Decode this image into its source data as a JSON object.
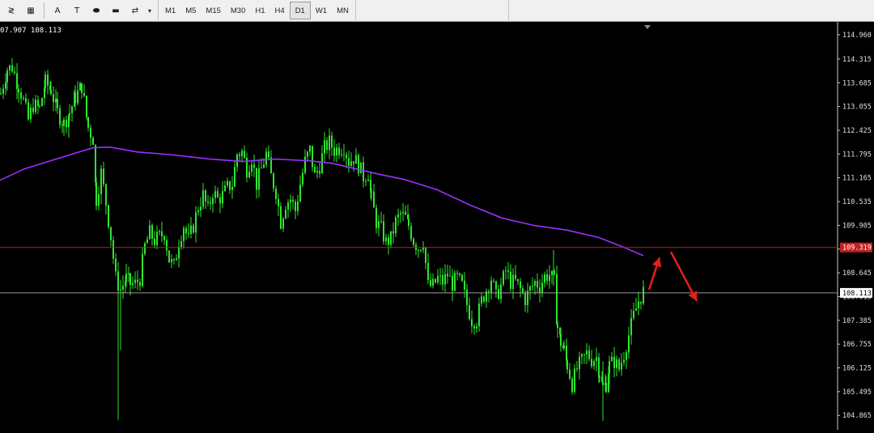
{
  "toolbar": {
    "tools": [
      {
        "name": "fibonacci-icon",
        "glyph": "≷"
      },
      {
        "name": "grid-icon",
        "glyph": "▦"
      },
      {
        "name": "text-icon",
        "glyph": "A"
      },
      {
        "name": "text-label-icon",
        "glyph": "T"
      },
      {
        "name": "ellipse-icon",
        "glyph": "⬬"
      },
      {
        "name": "rectangle-icon",
        "glyph": "▬"
      },
      {
        "name": "arrows-icon",
        "glyph": "⇄"
      }
    ],
    "dropdown_glyph": "▾",
    "timeframes": [
      "M1",
      "M5",
      "M15",
      "M30",
      "H1",
      "H4",
      "D1",
      "W1",
      "MN"
    ],
    "active_timeframe": "D1"
  },
  "chart_data": {
    "type": "candlestick",
    "header_text": "07.907 108.113",
    "price_labels": [
      "114.960",
      "114.315",
      "113.685",
      "113.055",
      "112.425",
      "111.795",
      "111.165",
      "110.535",
      "109.905",
      "109.275",
      "108.645",
      "108.015",
      "107.385",
      "106.755",
      "106.125",
      "105.495",
      "104.865"
    ],
    "ylim": [
      104.72,
      115.15
    ],
    "current_price": "108.113",
    "current_price_value": 108.113,
    "resistance_label": "109.319",
    "resistance_value": 109.319,
    "moving_average": {
      "color": "#9b30ff",
      "points": [
        [
          0,
          111.1
        ],
        [
          30,
          111.4
        ],
        [
          60,
          111.6
        ],
        [
          90,
          111.8
        ],
        [
          115,
          111.96
        ],
        [
          135,
          111.98
        ],
        [
          170,
          111.85
        ],
        [
          210,
          111.78
        ],
        [
          260,
          111.66
        ],
        [
          300,
          111.6
        ],
        [
          340,
          111.66
        ],
        [
          380,
          111.62
        ],
        [
          410,
          111.55
        ],
        [
          440,
          111.4
        ],
        [
          470,
          111.25
        ],
        [
          500,
          111.12
        ],
        [
          540,
          110.85
        ],
        [
          580,
          110.45
        ],
        [
          620,
          110.1
        ],
        [
          660,
          109.9
        ],
        [
          700,
          109.78
        ],
        [
          740,
          109.58
        ],
        [
          770,
          109.33
        ],
        [
          795,
          109.1
        ]
      ]
    },
    "price_path": [
      [
        0,
        113.4
      ],
      [
        8,
        114.05
      ],
      [
        14,
        114.1
      ],
      [
        22,
        113.6
      ],
      [
        28,
        113.2
      ],
      [
        34,
        112.7
      ],
      [
        40,
        113.1
      ],
      [
        48,
        113.0
      ],
      [
        55,
        113.7
      ],
      [
        62,
        113.5
      ],
      [
        70,
        112.9
      ],
      [
        78,
        112.6
      ],
      [
        85,
        112.9
      ],
      [
        92,
        113.3
      ],
      [
        100,
        113.6
      ],
      [
        108,
        112.5
      ],
      [
        114,
        112.2
      ],
      [
        118,
        110.6
      ],
      [
        124,
        111.3
      ],
      [
        130,
        110.5
      ],
      [
        136,
        109.6
      ],
      [
        142,
        108.5
      ],
      [
        148,
        108.2
      ],
      [
        155,
        108.5
      ],
      [
        160,
        108.35
      ],
      [
        166,
        108.35
      ],
      [
        172,
        108.5
      ],
      [
        178,
        109.35
      ],
      [
        184,
        109.7
      ],
      [
        190,
        109.5
      ],
      [
        196,
        109.6
      ],
      [
        202,
        109.7
      ],
      [
        208,
        109.0
      ],
      [
        214,
        108.8
      ],
      [
        220,
        109.5
      ],
      [
        226,
        109.9
      ],
      [
        232,
        109.5
      ],
      [
        238,
        109.9
      ],
      [
        244,
        110.4
      ],
      [
        250,
        110.7
      ],
      [
        256,
        110.3
      ],
      [
        262,
        110.8
      ],
      [
        268,
        110.6
      ],
      [
        274,
        110.7
      ],
      [
        280,
        110.9
      ],
      [
        286,
        111.0
      ],
      [
        292,
        111.8
      ],
      [
        298,
        111.85
      ],
      [
        304,
        111.4
      ],
      [
        310,
        111.7
      ],
      [
        316,
        111.0
      ],
      [
        322,
        111.4
      ],
      [
        328,
        111.8
      ],
      [
        334,
        111.2
      ],
      [
        340,
        110.8
      ],
      [
        346,
        110.0
      ],
      [
        352,
        110.5
      ],
      [
        358,
        110.6
      ],
      [
        364,
        110.3
      ],
      [
        370,
        111.0
      ],
      [
        376,
        111.6
      ],
      [
        382,
        111.9
      ],
      [
        388,
        111.2
      ],
      [
        394,
        111.5
      ],
      [
        400,
        111.95
      ],
      [
        406,
        112.1
      ],
      [
        412,
        111.9
      ],
      [
        418,
        111.95
      ],
      [
        424,
        112.0
      ],
      [
        430,
        111.6
      ],
      [
        436,
        111.7
      ],
      [
        442,
        111.5
      ],
      [
        448,
        111.2
      ],
      [
        454,
        111.3
      ],
      [
        458,
        110.6
      ],
      [
        464,
        110.0
      ],
      [
        470,
        109.8
      ],
      [
        476,
        109.45
      ],
      [
        482,
        109.55
      ],
      [
        488,
        110.0
      ],
      [
        494,
        110.2
      ],
      [
        500,
        110.1
      ],
      [
        504,
        109.9
      ],
      [
        510,
        109.5
      ],
      [
        516,
        109.3
      ],
      [
        522,
        109.5
      ],
      [
        528,
        108.3
      ],
      [
        534,
        108.3
      ],
      [
        540,
        108.5
      ],
      [
        546,
        108.4
      ],
      [
        552,
        108.6
      ],
      [
        558,
        108.35
      ],
      [
        564,
        108.5
      ],
      [
        570,
        108.3
      ],
      [
        576,
        107.8
      ],
      [
        582,
        107.4
      ],
      [
        588,
        107.4
      ],
      [
        594,
        107.9
      ],
      [
        600,
        108.2
      ],
      [
        606,
        108.5
      ],
      [
        612,
        108.0
      ],
      [
        618,
        108.3
      ],
      [
        624,
        108.7
      ],
      [
        630,
        108.4
      ],
      [
        636,
        108.4
      ],
      [
        642,
        108.2
      ],
      [
        648,
        107.95
      ],
      [
        654,
        108.2
      ],
      [
        660,
        108.4
      ],
      [
        666,
        108.3
      ],
      [
        672,
        108.55
      ],
      [
        678,
        108.6
      ],
      [
        684,
        108.4
      ],
      [
        688,
        107.2
      ],
      [
        692,
        106.8
      ],
      [
        696,
        106.6
      ],
      [
        700,
        106.2
      ],
      [
        706,
        105.7
      ],
      [
        712,
        106.1
      ],
      [
        718,
        106.3
      ],
      [
        724,
        106.5
      ],
      [
        730,
        106.35
      ],
      [
        736,
        106.4
      ],
      [
        740,
        106.0
      ],
      [
        744,
        105.6
      ],
      [
        748,
        105.7
      ],
      [
        752,
        106.2
      ],
      [
        758,
        106.3
      ],
      [
        764,
        106.1
      ],
      [
        770,
        106.5
      ],
      [
        776,
        107.0
      ],
      [
        782,
        107.5
      ],
      [
        788,
        107.9
      ],
      [
        794,
        108.15
      ]
    ],
    "spikes": [
      [
        146,
        108.2,
        104.75
      ],
      [
        149,
        108.3,
        106.6
      ],
      [
        684,
        109.25,
        108.3
      ],
      [
        745,
        106.3,
        104.72
      ]
    ],
    "arrows": [
      {
        "from": [
          802,
          108.2
        ],
        "to": [
          815,
          109.05
        ],
        "color": "#e0201b"
      },
      {
        "from": [
          829,
          109.2
        ],
        "to": [
          861,
          107.9
        ],
        "color": "#e0201b"
      }
    ],
    "colors": {
      "candle": "#2ee62e",
      "resistance": "#c21f1f",
      "current_line": "#9a9a9a",
      "axis": "#c8c8c8",
      "label_text": "#e0e0e0"
    }
  }
}
